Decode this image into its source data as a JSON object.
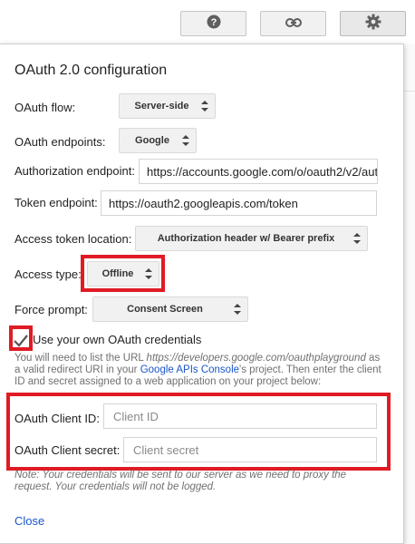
{
  "toolbar": {
    "help_icon": "question-circle-icon",
    "link_icon": "link-icon",
    "settings_icon": "gear-icon"
  },
  "panel": {
    "title": "OAuth 2.0 configuration",
    "oauth_flow": {
      "label": "OAuth flow:",
      "value": "Server-side"
    },
    "oauth_endpoints": {
      "label": "OAuth endpoints:",
      "value": "Google"
    },
    "authorization_endpoint": {
      "label": "Authorization endpoint:",
      "value": "https://accounts.google.com/o/oauth2/v2/aut"
    },
    "token_endpoint": {
      "label": "Token endpoint:",
      "value": "https://oauth2.googleapis.com/token"
    },
    "access_token_location": {
      "label": "Access token location:",
      "value": "Authorization header w/ Bearer prefix"
    },
    "access_type": {
      "label": "Access type:",
      "value": "Offline"
    },
    "force_prompt": {
      "label": "Force prompt:",
      "value": "Consent Screen"
    },
    "own_credentials": {
      "label": "Use your own OAuth credentials",
      "checked": true
    },
    "info": {
      "text_before": "You will need to list the URL ",
      "url": "https://developers.google.com/oauthplayground",
      "text_middle": " as a valid redirect URI in your ",
      "link": "Google APIs Console",
      "text_after": "'s project. Then enter the client ID and secret assigned to a web application on your project below:"
    },
    "client_id": {
      "label": "OAuth Client ID:",
      "placeholder": "Client ID"
    },
    "client_secret": {
      "label": "OAuth Client secret:",
      "placeholder": "Client secret"
    },
    "note": "Note: Your credentials will be sent to our server as we need to proxy the request. Your credentials will not be logged.",
    "close_label": "Close"
  },
  "colors": {
    "highlight": "#e01b24",
    "link": "#1a55c8"
  }
}
